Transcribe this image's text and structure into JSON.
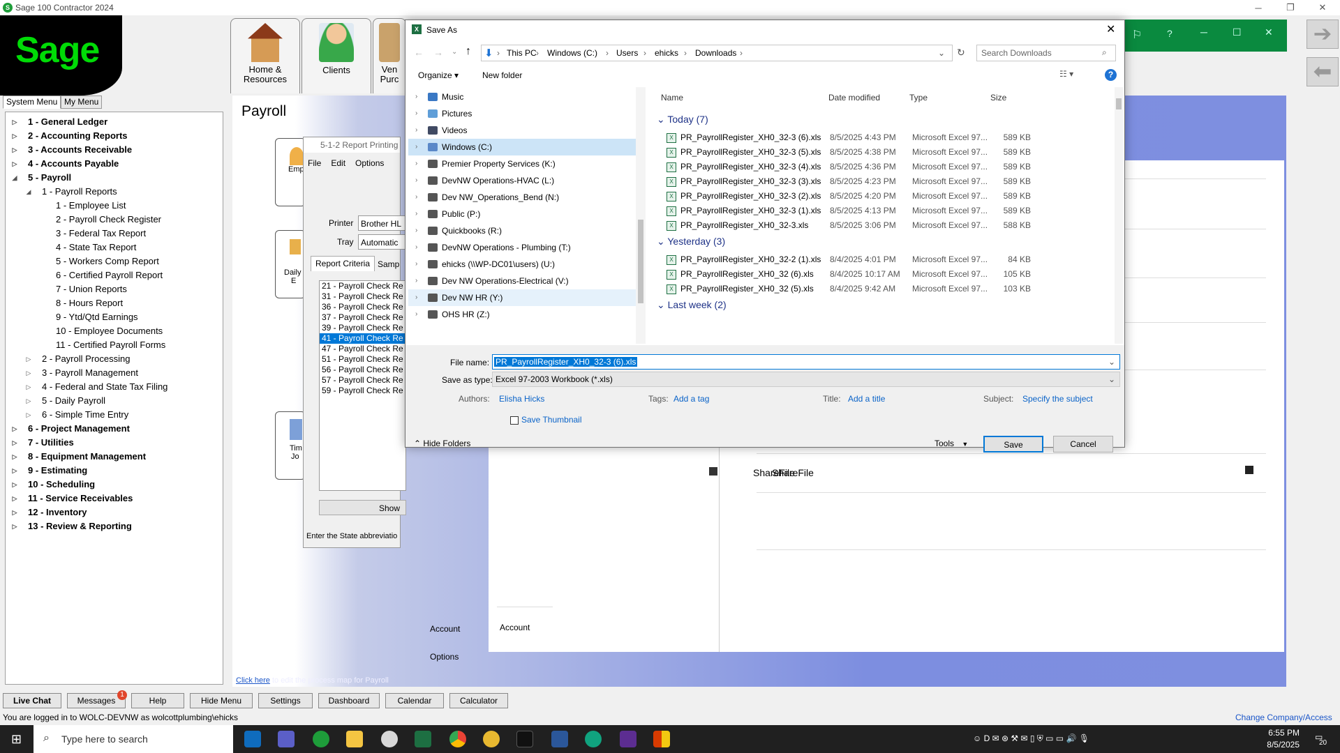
{
  "app": {
    "title": "Sage 100 Contractor 2024",
    "logo": "Sage"
  },
  "menu_tabs": [
    "System Menu",
    "My Menu"
  ],
  "tree": [
    {
      "label": "1 - General Ledger",
      "level": 0,
      "bold": true,
      "exp": "closed"
    },
    {
      "label": "2 - Accounting Reports",
      "level": 0,
      "bold": true,
      "exp": "closed"
    },
    {
      "label": "3 - Accounts Receivable",
      "level": 0,
      "bold": true,
      "exp": "closed"
    },
    {
      "label": "4 - Accounts Payable",
      "level": 0,
      "bold": true,
      "exp": "closed"
    },
    {
      "label": "5 - Payroll",
      "level": 0,
      "bold": true,
      "exp": "open"
    },
    {
      "label": "1 - Payroll Reports",
      "level": 1,
      "bold": false,
      "exp": "open"
    },
    {
      "label": "1 - Employee List",
      "level": 2,
      "bold": false,
      "exp": ""
    },
    {
      "label": "2 - Payroll Check Register",
      "level": 2,
      "bold": false,
      "exp": ""
    },
    {
      "label": "3 - Federal Tax Report",
      "level": 2,
      "bold": false,
      "exp": ""
    },
    {
      "label": "4 - State Tax Report",
      "level": 2,
      "bold": false,
      "exp": ""
    },
    {
      "label": "5 - Workers Comp Report",
      "level": 2,
      "bold": false,
      "exp": ""
    },
    {
      "label": "6 - Certified Payroll Report",
      "level": 2,
      "bold": false,
      "exp": ""
    },
    {
      "label": "7 - Union Reports",
      "level": 2,
      "bold": false,
      "exp": ""
    },
    {
      "label": "8 - Hours Report",
      "level": 2,
      "bold": false,
      "exp": ""
    },
    {
      "label": "9 - Ytd/Qtd Earnings",
      "level": 2,
      "bold": false,
      "exp": ""
    },
    {
      "label": "10 - Employee Documents",
      "level": 2,
      "bold": false,
      "exp": ""
    },
    {
      "label": "11 - Certified Payroll Forms",
      "level": 2,
      "bold": false,
      "exp": ""
    },
    {
      "label": "2 - Payroll Processing",
      "level": 1,
      "bold": false,
      "exp": "closed"
    },
    {
      "label": "3 - Payroll Management",
      "level": 1,
      "bold": false,
      "exp": "closed"
    },
    {
      "label": "4 - Federal and State Tax Filing",
      "level": 1,
      "bold": false,
      "exp": "closed"
    },
    {
      "label": "5 - Daily Payroll",
      "level": 1,
      "bold": false,
      "exp": "closed"
    },
    {
      "label": "6 - Simple Time Entry",
      "level": 1,
      "bold": false,
      "exp": "closed"
    },
    {
      "label": "6 - Project Management",
      "level": 0,
      "bold": true,
      "exp": "closed"
    },
    {
      "label": "7 - Utilities",
      "level": 0,
      "bold": true,
      "exp": "closed"
    },
    {
      "label": "8 - Equipment Management",
      "level": 0,
      "bold": true,
      "exp": "closed"
    },
    {
      "label": "9 - Estimating",
      "level": 0,
      "bold": true,
      "exp": "closed"
    },
    {
      "label": "10 - Scheduling",
      "level": 0,
      "bold": true,
      "exp": "closed"
    },
    {
      "label": "11 - Service Receivables",
      "level": 0,
      "bold": true,
      "exp": "closed"
    },
    {
      "label": "12 - Inventory",
      "level": 0,
      "bold": true,
      "exp": "closed"
    },
    {
      "label": "13 - Review & Reporting",
      "level": 0,
      "bold": true,
      "exp": "closed"
    }
  ],
  "toolbar": {
    "home": "Home &\nResources",
    "clients": "Clients",
    "ven1": "Ven",
    "ven2": "Purc"
  },
  "payroll": {
    "title": "Payroll",
    "emp": "Emp",
    "daily": "Daily",
    "daily2": "E",
    "tim": "Tim",
    "tim2": "Jo",
    "click_here": "Click here",
    "process_text": " to edit the process map for Payroll"
  },
  "dash": {
    "account": "Account",
    "options": "Options",
    "sharefile": "ShareFile"
  },
  "rp": {
    "title": "5-1-2 Report Printing",
    "menu": [
      "File",
      "Edit",
      "Options"
    ],
    "printer_label": "Printer",
    "printer_value": "Brother HL",
    "tray_label": "Tray",
    "tray_value": "Automatic",
    "tabs": [
      "Report Criteria",
      "Samp"
    ],
    "items": [
      "21 - Payroll Check Re",
      "31 - Payroll Check Re",
      "36 - Payroll Check Re",
      "37 - Payroll Check Re",
      "39 - Payroll Check Re",
      "41 - Payroll Check Re",
      "47 - Payroll Check Re",
      "51 - Payroll Check Re",
      "56 - Payroll Check Re",
      "57 - Payroll Check Re",
      "59 - Payroll Check Re"
    ],
    "selected_index": 5,
    "show": "Show",
    "status": "Enter the State abbreviatio"
  },
  "dlg": {
    "title": "Save As",
    "crumbs": [
      "This PC",
      "Windows (C:)",
      "Users",
      "ehicks",
      "Downloads"
    ],
    "search_placeholder": "Search Downloads",
    "organize": "Organize ▾",
    "new_folder": "New folder",
    "nav": [
      {
        "label": "Music",
        "type": "music"
      },
      {
        "label": "Pictures",
        "type": "pictures"
      },
      {
        "label": "Videos",
        "type": "videos"
      },
      {
        "label": "Windows (C:)",
        "type": "drive",
        "selected": true
      },
      {
        "label": "Premier Property Services (K:)",
        "type": "net"
      },
      {
        "label": "DevNW Operations-HVAC (L:)",
        "type": "net"
      },
      {
        "label": "Dev NW_Operations_Bend (N:)",
        "type": "net"
      },
      {
        "label": "Public (P:)",
        "type": "net"
      },
      {
        "label": "Quickbooks (R:)",
        "type": "net"
      },
      {
        "label": "DevNW Operations - Plumbing (T:)",
        "type": "net"
      },
      {
        "label": "ehicks (\\\\WP-DC01\\users) (U:)",
        "type": "net"
      },
      {
        "label": "Dev NW Operations-Electrical (V:)",
        "type": "net"
      },
      {
        "label": "Dev NW HR (Y:)",
        "type": "net",
        "hover": true
      },
      {
        "label": "OHS HR (Z:)",
        "type": "net"
      }
    ],
    "columns": [
      "Name",
      "Date modified",
      "Type",
      "Size"
    ],
    "groups": [
      {
        "label": "Today (7)",
        "files": [
          {
            "name": "PR_PayrollRegister_XH0_32-3 (6).xls",
            "date": "8/5/2025 4:43 PM",
            "type": "Microsoft Excel 97...",
            "size": "589 KB"
          },
          {
            "name": "PR_PayrollRegister_XH0_32-3 (5).xls",
            "date": "8/5/2025 4:38 PM",
            "type": "Microsoft Excel 97...",
            "size": "589 KB"
          },
          {
            "name": "PR_PayrollRegister_XH0_32-3 (4).xls",
            "date": "8/5/2025 4:36 PM",
            "type": "Microsoft Excel 97...",
            "size": "589 KB"
          },
          {
            "name": "PR_PayrollRegister_XH0_32-3 (3).xls",
            "date": "8/5/2025 4:23 PM",
            "type": "Microsoft Excel 97...",
            "size": "589 KB"
          },
          {
            "name": "PR_PayrollRegister_XH0_32-3 (2).xls",
            "date": "8/5/2025 4:20 PM",
            "type": "Microsoft Excel 97...",
            "size": "589 KB"
          },
          {
            "name": "PR_PayrollRegister_XH0_32-3 (1).xls",
            "date": "8/5/2025 4:13 PM",
            "type": "Microsoft Excel 97...",
            "size": "589 KB"
          },
          {
            "name": "PR_PayrollRegister_XH0_32-3.xls",
            "date": "8/5/2025 3:06 PM",
            "type": "Microsoft Excel 97...",
            "size": "588 KB"
          }
        ]
      },
      {
        "label": "Yesterday (3)",
        "files": [
          {
            "name": "PR_PayrollRegister_XH0_32-2 (1).xls",
            "date": "8/4/2025 4:01 PM",
            "type": "Microsoft Excel 97...",
            "size": "84 KB"
          },
          {
            "name": "PR_PayrollRegister_XH0_32 (6).xls",
            "date": "8/4/2025 10:17 AM",
            "type": "Microsoft Excel 97...",
            "size": "105 KB"
          },
          {
            "name": "PR_PayrollRegister_XH0_32 (5).xls",
            "date": "8/4/2025 9:42 AM",
            "type": "Microsoft Excel 97...",
            "size": "103 KB"
          }
        ]
      },
      {
        "label": "Last week (2)",
        "files": []
      }
    ],
    "filename_label": "File name:",
    "filename": "PR_PayrollRegister_XH0_32-3 (6).xls",
    "type_label": "Save as type:",
    "type_value": "Excel 97-2003 Workbook (*.xls)",
    "authors_label": "Authors:",
    "authors": "Elisha Hicks",
    "tags_label": "Tags:",
    "tags": "Add a tag",
    "title_label": "Title:",
    "title_value": "Add a title",
    "subject_label": "Subject:",
    "subject": "Specify the subject",
    "thumb": "Save Thumbnail",
    "hide": "Hide Folders",
    "tools": "Tools",
    "save": "Save",
    "cancel": "Cancel"
  },
  "bottom": {
    "buttons": [
      "Live Chat",
      "Messages",
      "Help",
      "Hide Menu",
      "Settings",
      "Dashboard",
      "Calendar",
      "Calculator"
    ],
    "badge": "1",
    "status": "You are logged in to WOLC-DEVNW as wolcottplumbing\\ehicks",
    "change": "Change Company/Access"
  },
  "taskbar": {
    "search": "Type here to search",
    "time": "6:55 PM",
    "date": "8/5/2025",
    "notif": "20"
  },
  "colors": {
    "sage_green": "#00dc06",
    "select_blue": "#0078d7",
    "link": "#0a63c8"
  }
}
